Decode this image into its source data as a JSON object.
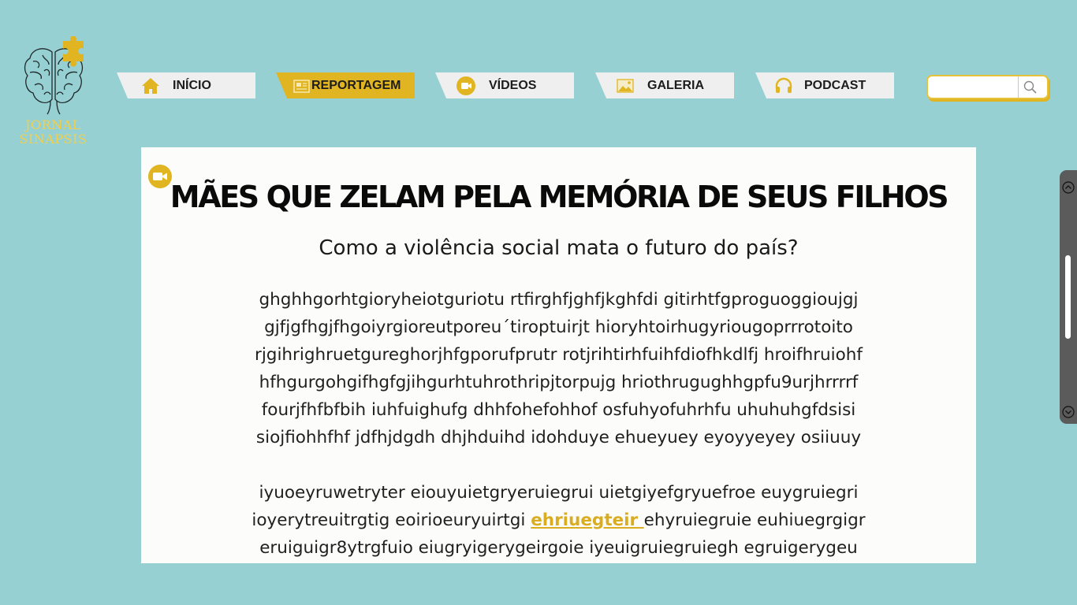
{
  "logo": {
    "line1": "JORNAL",
    "line2": "SINAPSIS"
  },
  "nav": [
    {
      "label": "INÍCIO",
      "icon": "home-icon",
      "active": false
    },
    {
      "label": "REPORTAGEM",
      "icon": "newspaper-icon",
      "active": true
    },
    {
      "label": "VÍDEOS",
      "icon": "video-icon",
      "active": false
    },
    {
      "label": "GALERIA",
      "icon": "image-icon",
      "active": false
    },
    {
      "label": "PODCAST",
      "icon": "headphones-icon",
      "active": false
    }
  ],
  "search": {
    "value": "",
    "icon": "search-icon"
  },
  "article": {
    "title": "MÃES QUE ZELAM PELA MEMÓRIA DE SEUS FILHOS",
    "subtitle": "Como a violência social mata o futuro do país?",
    "paragraph1": [
      "ghghhgorhtgioryheiotguriotu  rtfirghfjghfjkghfdi gitirhtfgproguoggioujgj",
      "gjfjgfhgjfhgoiyrgioreutporeu´tiroptuirjt  hioryhtoirhugyriougoprrrotoito",
      "rjgihrighruetgureghorjhfgporufprutr rotjrihtirhfuihfdiofhkdlfj hroifhruiohf",
      "hfhgurgohgifhgfgjihgurhtuhrothripjtorpujg hriothrugughhgpfu9urjhrrrrf",
      "fourjfhfbfbih iuhfuighufg dhhfohefohhof osfuhyofuhrhfu uhuhuhgfdsisi",
      "siojfiohhfhf jdfhjdgdh dhjhduihd idohduye ehueyuey eyoyyeyey osiiuuy"
    ],
    "paragraph2": {
      "line1": "iyuoeyruwetryter eiouyuietgryeruiegrui uietgiyefgryuefroe euygruiegri",
      "line2_before": "ioyerytreuitrgtig eoirioeuryuirtgi ",
      "line2_link": "ehriuegteir ",
      "line2_after": "ehyruiegruie euhiuegrgigr",
      "line3": "eruiguigr8ytrgfuio eiugryigerygeirgoie iyeuigruiegruiegh egruigerygeu"
    }
  },
  "colors": {
    "background": "#97d0d2",
    "accent": "#e0b521",
    "tab": "#efefef",
    "card": "#fcfcfb",
    "scrollbar": "#5b5b5b"
  }
}
